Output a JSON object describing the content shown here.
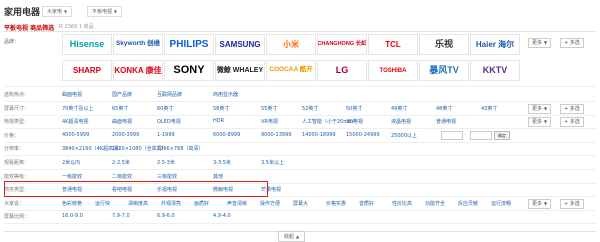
{
  "header": {
    "title": "家用电器",
    "crumbs": [
      {
        "label": "大家电"
      },
      {
        "label": "平板电视"
      }
    ]
  },
  "subheader": {
    "title": "平板电视 商品筛选",
    "hint": "共 2369 1 商品"
  },
  "brand_row": {
    "label": "品牌：",
    "brands": [
      {
        "name": "Hisense",
        "icon": "hisense-logo",
        "color": "#00a39d"
      },
      {
        "name": "Skyworth 创维",
        "icon": "skyworth-logo",
        "color": "#1a56a8"
      },
      {
        "name": "PHILIPS",
        "icon": "philips-logo",
        "color": "#0b5ed7"
      },
      {
        "name": "SAMSUNG",
        "icon": "samsung-logo",
        "color": "#1428a0"
      },
      {
        "name": "小米",
        "icon": "mi-logo",
        "color": "#ff6900"
      },
      {
        "name": "CHANGHONG 长虹",
        "icon": "changhong-logo",
        "color": "#d7000f"
      },
      {
        "name": "TCL",
        "icon": "tcl-logo",
        "color": "#e60012"
      },
      {
        "name": "乐视",
        "icon": "letv-logo",
        "color": "#333333"
      },
      {
        "name": "Haier 海尔",
        "icon": "haier-logo",
        "color": "#1d5cae"
      },
      {
        "name": "SHARP",
        "icon": "sharp-logo",
        "color": "#d7000f"
      },
      {
        "name": "KONKA 康佳",
        "icon": "konka-logo",
        "color": "#e60012"
      },
      {
        "name": "SONY",
        "icon": "sony-logo",
        "color": "#000000"
      },
      {
        "name": "微鲸 WHALEY",
        "icon": "whaley-logo",
        "color": "#1a1a1a"
      },
      {
        "name": "COOCAA 酷开",
        "icon": "coocaa-logo",
        "color": "#f39800"
      },
      {
        "name": "LG",
        "icon": "lg-logo",
        "color": "#a50034"
      },
      {
        "name": "TOSHIBA",
        "icon": "toshiba-logo",
        "color": "#e60012"
      },
      {
        "name": "暴风TV",
        "icon": "baofeng-logo",
        "color": "#1c6fbf"
      },
      {
        "name": "KKTV",
        "icon": "kktv-logo",
        "color": "#5b2d8c"
      }
    ],
    "more_label": "更多",
    "multi_label": "+ 多选"
  },
  "filter_rows": [
    {
      "label": "选购热点：",
      "options": [
        "曲面电视",
        "国产品牌",
        "互联网品牌",
        "商用显示器"
      ],
      "more": false
    },
    {
      "label": "屏幕尺寸：",
      "options": [
        "70英寸及以上",
        "65英寸",
        "60英寸",
        "58英寸",
        "55英寸",
        "52英寸",
        "50英寸",
        "49英寸",
        "48英寸",
        "43英寸",
        "40英寸"
      ],
      "more": true
    },
    {
      "label": "电视类型：",
      "options": [
        "4K超清电视",
        "曲面电视",
        "OLED电视",
        "HDR",
        "VR电视",
        "人工智能（小于20mm）",
        "3D电视",
        "液晶电视",
        "普通电视"
      ],
      "more": true
    },
    {
      "label": "价格：",
      "options": [
        "4000-5999",
        "2000-3999",
        "1-1999",
        "6000-8999",
        "9000-13999",
        "14000-18999",
        "15000-24999",
        "25000以上"
      ],
      "more": false,
      "confirm": "确定"
    },
    {
      "label": "分辨率：",
      "options": [
        "3840×2160（4K超高清）",
        "1920×1080（全高清）",
        "1366×768（高清）"
      ],
      "more": false
    },
    {
      "label": "观看距离：",
      "options": [
        "2米以内",
        "2-2.5米",
        "2.5-3米",
        "3-3.5米",
        "3.5米以上"
      ],
      "more": false
    },
    {
      "label": "能效等级：",
      "options": [
        "一级能效",
        "二级能效",
        "三级能效",
        "其他"
      ],
      "more": false
    },
    {
      "label": "商务类型：",
      "options": [
        "普通电视",
        "看吧电视",
        "乐视电视",
        "微鲸电视",
        "芒果电视"
      ],
      "more": false
    },
    {
      "label": "大家说：",
      "options": [
        "色彩鲜艳",
        "运行快",
        "清晰度高",
        "外观漂亮",
        "画质好",
        "声音清晰",
        "操作方便",
        "屏幕大",
        "价格实惠",
        "音质好",
        "性价比高",
        "功能齐全",
        "反应灵敏",
        "运行流畅"
      ],
      "more": true
    },
    {
      "label": "屏幕比例：",
      "options": [
        "16.0-9.0",
        "7.9-7.0",
        "6.9-6.0",
        "4.9-4.0"
      ],
      "more": false
    }
  ],
  "pager": {
    "collapse_label": "收起"
  }
}
